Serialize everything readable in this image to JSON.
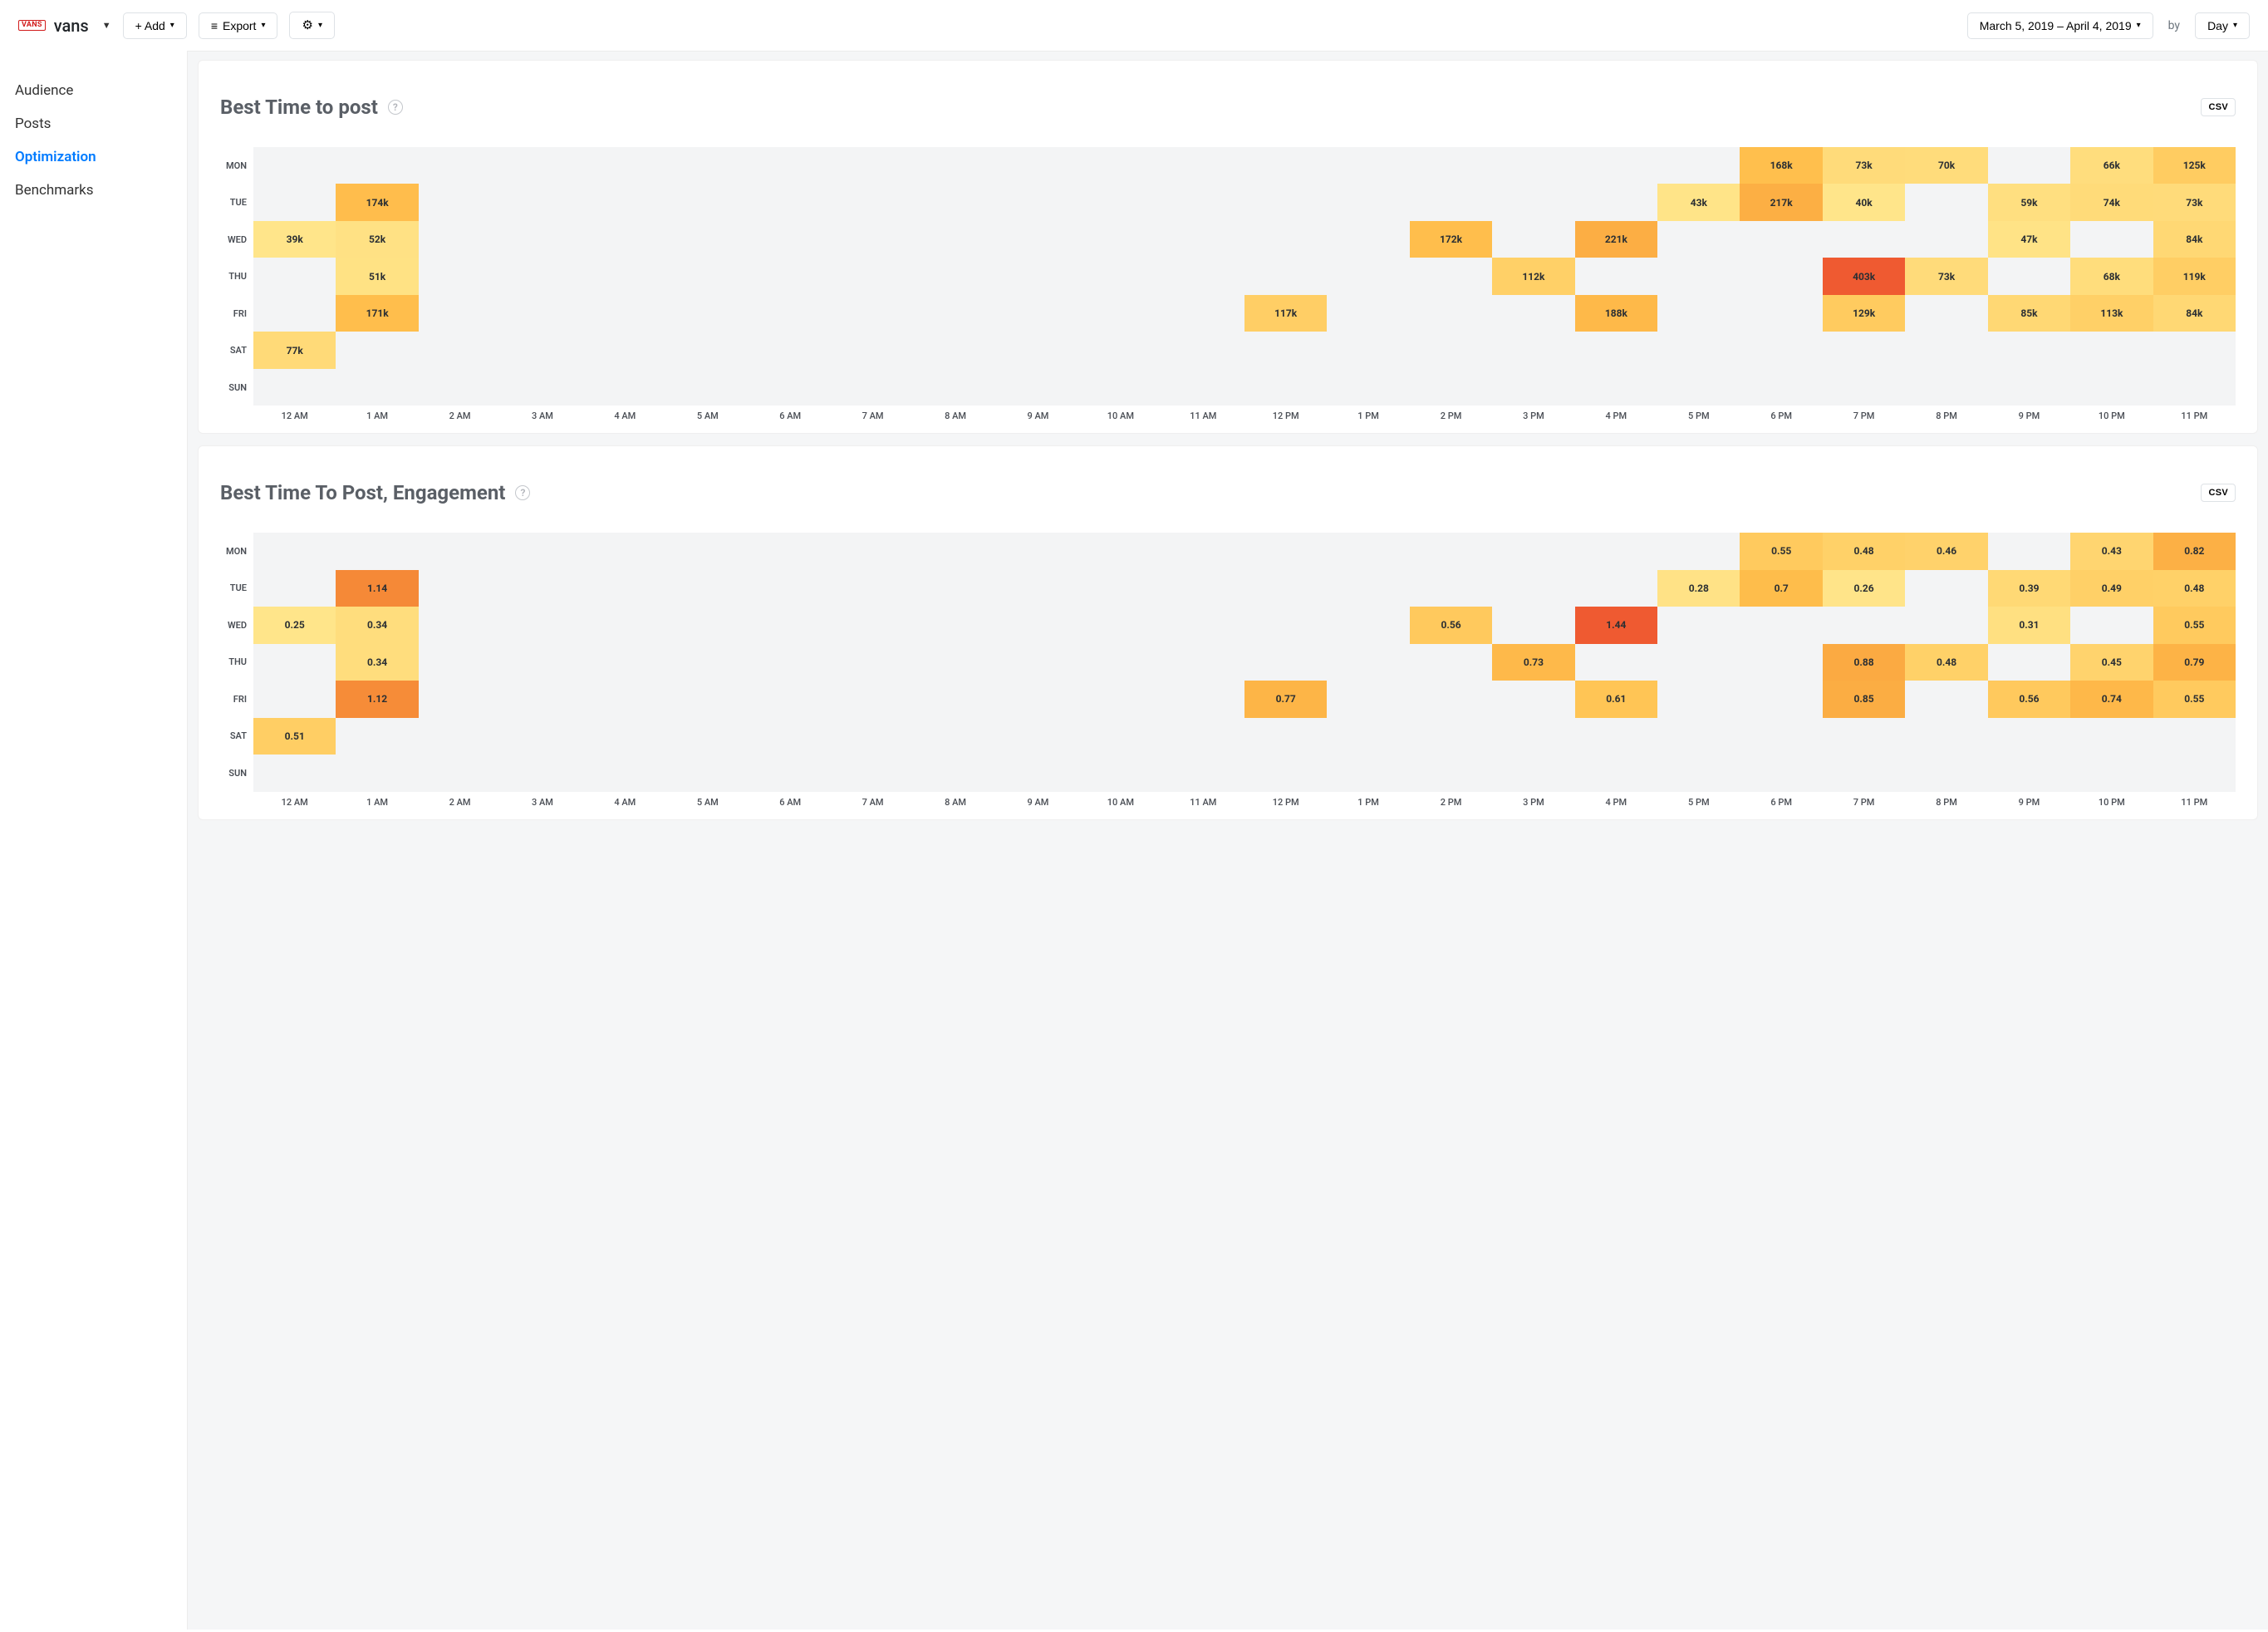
{
  "header": {
    "brand_badge": "VANS",
    "brand_name": "vans",
    "add_label": "+ Add",
    "export_label": "Export",
    "date_range": "March 5, 2019 – April 4, 2019",
    "by_label": "by",
    "group_by": "Day"
  },
  "sidebar": {
    "items": [
      {
        "label": "Audience",
        "active": false
      },
      {
        "label": "Posts",
        "active": false
      },
      {
        "label": "Optimization",
        "active": true
      },
      {
        "label": "Benchmarks",
        "active": false
      }
    ]
  },
  "csv_label": "CSV",
  "day_labels": [
    "MON",
    "TUE",
    "WED",
    "THU",
    "FRI",
    "SAT",
    "SUN"
  ],
  "hour_labels": [
    "12 AM",
    "1 AM",
    "2 AM",
    "3 AM",
    "4 AM",
    "5 AM",
    "6 AM",
    "7 AM",
    "8 AM",
    "9 AM",
    "10 AM",
    "11 AM",
    "12 PM",
    "1 PM",
    "2 PM",
    "3 PM",
    "4 PM",
    "5 PM",
    "6 PM",
    "7 PM",
    "8 PM",
    "9 PM",
    "10 PM",
    "11 PM"
  ],
  "chart_data": [
    {
      "id": "best_time_to_post",
      "type": "heatmap",
      "title": "Best Time to post",
      "x": [
        "12 AM",
        "1 AM",
        "2 AM",
        "3 AM",
        "4 AM",
        "5 AM",
        "6 AM",
        "7 AM",
        "8 AM",
        "9 AM",
        "10 AM",
        "11 AM",
        "12 PM",
        "1 PM",
        "2 PM",
        "3 PM",
        "4 PM",
        "5 PM",
        "6 PM",
        "7 PM",
        "8 PM",
        "9 PM",
        "10 PM",
        "11 PM"
      ],
      "y": [
        "MON",
        "TUE",
        "WED",
        "THU",
        "FRI",
        "SAT",
        "SUN"
      ],
      "value_format": "count_k",
      "cells": [
        {
          "day": "MON",
          "hour": 18,
          "label": "168k",
          "value": 168000
        },
        {
          "day": "MON",
          "hour": 19,
          "label": "73k",
          "value": 73000
        },
        {
          "day": "MON",
          "hour": 20,
          "label": "70k",
          "value": 70000
        },
        {
          "day": "MON",
          "hour": 22,
          "label": "66k",
          "value": 66000
        },
        {
          "day": "MON",
          "hour": 23,
          "label": "125k",
          "value": 125000
        },
        {
          "day": "TUE",
          "hour": 1,
          "label": "174k",
          "value": 174000
        },
        {
          "day": "TUE",
          "hour": 17,
          "label": "43k",
          "value": 43000
        },
        {
          "day": "TUE",
          "hour": 18,
          "label": "217k",
          "value": 217000
        },
        {
          "day": "TUE",
          "hour": 19,
          "label": "40k",
          "value": 40000
        },
        {
          "day": "TUE",
          "hour": 21,
          "label": "59k",
          "value": 59000
        },
        {
          "day": "TUE",
          "hour": 22,
          "label": "74k",
          "value": 74000
        },
        {
          "day": "TUE",
          "hour": 23,
          "label": "73k",
          "value": 73000
        },
        {
          "day": "WED",
          "hour": 0,
          "label": "39k",
          "value": 39000
        },
        {
          "day": "WED",
          "hour": 1,
          "label": "52k",
          "value": 52000
        },
        {
          "day": "WED",
          "hour": 14,
          "label": "172k",
          "value": 172000
        },
        {
          "day": "WED",
          "hour": 16,
          "label": "221k",
          "value": 221000
        },
        {
          "day": "WED",
          "hour": 21,
          "label": "47k",
          "value": 47000
        },
        {
          "day": "WED",
          "hour": 23,
          "label": "84k",
          "value": 84000
        },
        {
          "day": "THU",
          "hour": 1,
          "label": "51k",
          "value": 51000
        },
        {
          "day": "THU",
          "hour": 15,
          "label": "112k",
          "value": 112000
        },
        {
          "day": "THU",
          "hour": 19,
          "label": "403k",
          "value": 403000
        },
        {
          "day": "THU",
          "hour": 20,
          "label": "73k",
          "value": 73000
        },
        {
          "day": "THU",
          "hour": 22,
          "label": "68k",
          "value": 68000
        },
        {
          "day": "THU",
          "hour": 23,
          "label": "119k",
          "value": 119000
        },
        {
          "day": "FRI",
          "hour": 1,
          "label": "171k",
          "value": 171000
        },
        {
          "day": "FRI",
          "hour": 12,
          "label": "117k",
          "value": 117000
        },
        {
          "day": "FRI",
          "hour": 16,
          "label": "188k",
          "value": 188000
        },
        {
          "day": "FRI",
          "hour": 19,
          "label": "129k",
          "value": 129000
        },
        {
          "day": "FRI",
          "hour": 21,
          "label": "85k",
          "value": 85000
        },
        {
          "day": "FRI",
          "hour": 22,
          "label": "113k",
          "value": 113000
        },
        {
          "day": "FRI",
          "hour": 23,
          "label": "84k",
          "value": 84000
        },
        {
          "day": "SAT",
          "hour": 0,
          "label": "77k",
          "value": 77000
        }
      ],
      "range": [
        39000,
        403000
      ]
    },
    {
      "id": "best_time_to_post_engagement",
      "type": "heatmap",
      "title": "Best Time To Post, Engagement",
      "x": [
        "12 AM",
        "1 AM",
        "2 AM",
        "3 AM",
        "4 AM",
        "5 AM",
        "6 AM",
        "7 AM",
        "8 AM",
        "9 AM",
        "10 AM",
        "11 AM",
        "12 PM",
        "1 PM",
        "2 PM",
        "3 PM",
        "4 PM",
        "5 PM",
        "6 PM",
        "7 PM",
        "8 PM",
        "9 PM",
        "10 PM",
        "11 PM"
      ],
      "y": [
        "MON",
        "TUE",
        "WED",
        "THU",
        "FRI",
        "SAT",
        "SUN"
      ],
      "value_format": "decimal2",
      "cells": [
        {
          "day": "MON",
          "hour": 18,
          "label": "0.55",
          "value": 0.55
        },
        {
          "day": "MON",
          "hour": 19,
          "label": "0.48",
          "value": 0.48
        },
        {
          "day": "MON",
          "hour": 20,
          "label": "0.46",
          "value": 0.46
        },
        {
          "day": "MON",
          "hour": 22,
          "label": "0.43",
          "value": 0.43
        },
        {
          "day": "MON",
          "hour": 23,
          "label": "0.82",
          "value": 0.82
        },
        {
          "day": "TUE",
          "hour": 1,
          "label": "1.14",
          "value": 1.14
        },
        {
          "day": "TUE",
          "hour": 17,
          "label": "0.28",
          "value": 0.28
        },
        {
          "day": "TUE",
          "hour": 18,
          "label": "0.7",
          "value": 0.7
        },
        {
          "day": "TUE",
          "hour": 19,
          "label": "0.26",
          "value": 0.26
        },
        {
          "day": "TUE",
          "hour": 21,
          "label": "0.39",
          "value": 0.39
        },
        {
          "day": "TUE",
          "hour": 22,
          "label": "0.49",
          "value": 0.49
        },
        {
          "day": "TUE",
          "hour": 23,
          "label": "0.48",
          "value": 0.48
        },
        {
          "day": "WED",
          "hour": 0,
          "label": "0.25",
          "value": 0.25
        },
        {
          "day": "WED",
          "hour": 1,
          "label": "0.34",
          "value": 0.34
        },
        {
          "day": "WED",
          "hour": 14,
          "label": "0.56",
          "value": 0.56
        },
        {
          "day": "WED",
          "hour": 16,
          "label": "1.44",
          "value": 1.44
        },
        {
          "day": "WED",
          "hour": 21,
          "label": "0.31",
          "value": 0.31
        },
        {
          "day": "WED",
          "hour": 23,
          "label": "0.55",
          "value": 0.55
        },
        {
          "day": "THU",
          "hour": 1,
          "label": "0.34",
          "value": 0.34
        },
        {
          "day": "THU",
          "hour": 15,
          "label": "0.73",
          "value": 0.73
        },
        {
          "day": "THU",
          "hour": 19,
          "label": "0.88",
          "value": 0.88
        },
        {
          "day": "THU",
          "hour": 20,
          "label": "0.48",
          "value": 0.48
        },
        {
          "day": "THU",
          "hour": 22,
          "label": "0.45",
          "value": 0.45
        },
        {
          "day": "THU",
          "hour": 23,
          "label": "0.79",
          "value": 0.79
        },
        {
          "day": "FRI",
          "hour": 1,
          "label": "1.12",
          "value": 1.12
        },
        {
          "day": "FRI",
          "hour": 12,
          "label": "0.77",
          "value": 0.77
        },
        {
          "day": "FRI",
          "hour": 16,
          "label": "0.61",
          "value": 0.61
        },
        {
          "day": "FRI",
          "hour": 19,
          "label": "0.85",
          "value": 0.85
        },
        {
          "day": "FRI",
          "hour": 21,
          "label": "0.56",
          "value": 0.56
        },
        {
          "day": "FRI",
          "hour": 22,
          "label": "0.74",
          "value": 0.74
        },
        {
          "day": "FRI",
          "hour": 23,
          "label": "0.55",
          "value": 0.55
        },
        {
          "day": "SAT",
          "hour": 0,
          "label": "0.51",
          "value": 0.51
        }
      ],
      "range": [
        0.25,
        1.44
      ]
    }
  ]
}
